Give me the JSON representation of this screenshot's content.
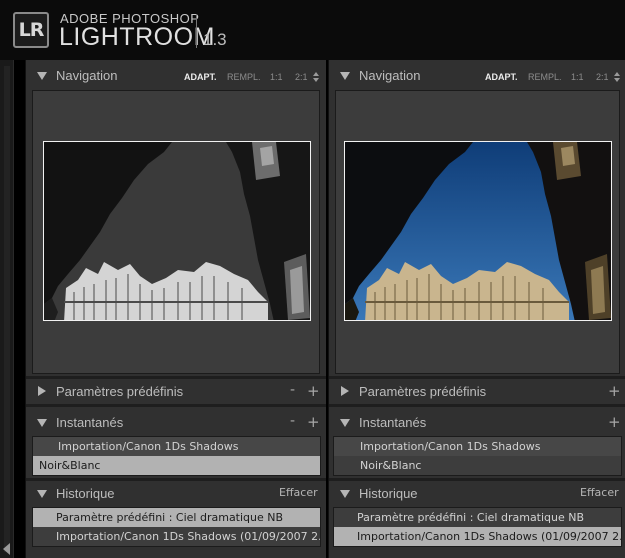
{
  "app": {
    "badge": "LR",
    "brand_small": "ADOBE PHOTOSHOP",
    "brand_big": "LIGHTROOM",
    "version": "1.3"
  },
  "panels": [
    {
      "navigation": {
        "title": "Navigation",
        "zoom": [
          {
            "label": "ADAPT.",
            "active": true
          },
          {
            "label": "REMPL.",
            "active": false
          },
          {
            "label": "1:1",
            "active": false
          },
          {
            "label": "2:1",
            "active": false
          }
        ],
        "photo_mode": "black-and-white"
      },
      "presets": {
        "title": "Paramètres prédéfinis",
        "minus": "-",
        "plus": "+"
      },
      "snapshots": {
        "title": "Instantanés",
        "minus": "-",
        "plus": "+",
        "items": [
          {
            "label": "Importation/Canon 1Ds Shadows",
            "selected": false
          },
          {
            "label": "Noir&Blanc",
            "selected": true
          }
        ]
      },
      "history": {
        "title": "Historique",
        "clear": "Effacer",
        "items": [
          {
            "label": "Paramètre prédéfini : Ciel dramatique NB",
            "selected": true
          },
          {
            "label": "Importation/Canon 1Ds Shadows (01/09/2007 2...",
            "selected": false
          }
        ]
      }
    },
    {
      "navigation": {
        "title": "Navigation",
        "zoom": [
          {
            "label": "ADAPT.",
            "active": true
          },
          {
            "label": "REMPL.",
            "active": false
          },
          {
            "label": "1:1",
            "active": false
          },
          {
            "label": "2:1",
            "active": false
          }
        ],
        "photo_mode": "color"
      },
      "presets": {
        "title": "Paramètres prédéfinis",
        "plus": "+"
      },
      "snapshots": {
        "title": "Instantanés",
        "plus": "+",
        "items": [
          {
            "label": "Importation/Canon 1Ds Shadows",
            "selected": false
          },
          {
            "label": "Noir&Blanc",
            "selected": false
          }
        ]
      },
      "history": {
        "title": "Historique",
        "clear": "Effacer",
        "items": [
          {
            "label": "Paramètre prédéfini : Ciel dramatique NB",
            "selected": false
          },
          {
            "label": "Importation/Canon 1Ds Shadows (01/09/2007 2...",
            "selected": true
          }
        ]
      }
    }
  ],
  "colors": {
    "panel_bg": "#303030",
    "selected_row": "#b2b2b2",
    "sky_bw": "#3a3a3a",
    "sky_color": "#1d4f8c"
  }
}
